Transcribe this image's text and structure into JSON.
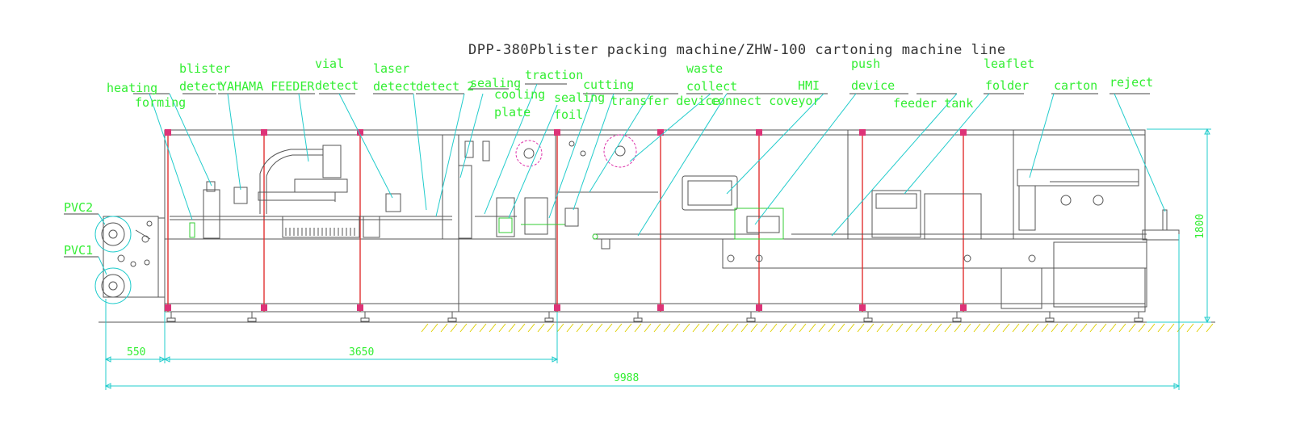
{
  "title": "DPP-380Pblister packing machine/ZHW-100 cartoning machine line",
  "labels": {
    "heating": "heating",
    "forming": "forming",
    "blister": "blister",
    "detect": "detect",
    "yahama_feeder": "YAHAMA FEEDER",
    "vial": "vial",
    "vial_detect": "detect",
    "laser": "laser",
    "laser_detect": "detect",
    "detect2": "detect 2",
    "sealing": "sealing",
    "cooling": "cooling",
    "plate": "plate",
    "traction": "traction",
    "sealing2": "sealing",
    "foil": "foil",
    "cutting": "cutting",
    "transfer_device": "transfer device",
    "waste": "waste",
    "collect": "collect",
    "connect_conveyor": "connect coveyor",
    "hmi": "HMI",
    "push": "push",
    "device": "device",
    "feeder_tank": "feeder tank",
    "leaflet": "leaflet",
    "folder": "folder",
    "carton": "carton",
    "reject": "reject",
    "pvc2": "PVC2",
    "pvc1": "PVC1"
  },
  "dimensions": {
    "d550": "550",
    "d3650": "3650",
    "d9988": "9988",
    "d1800": "1800"
  },
  "colors": {
    "label": "#33ee33",
    "leader": "#22cccc",
    "frame": "#e03030",
    "machine": "#555555"
  }
}
